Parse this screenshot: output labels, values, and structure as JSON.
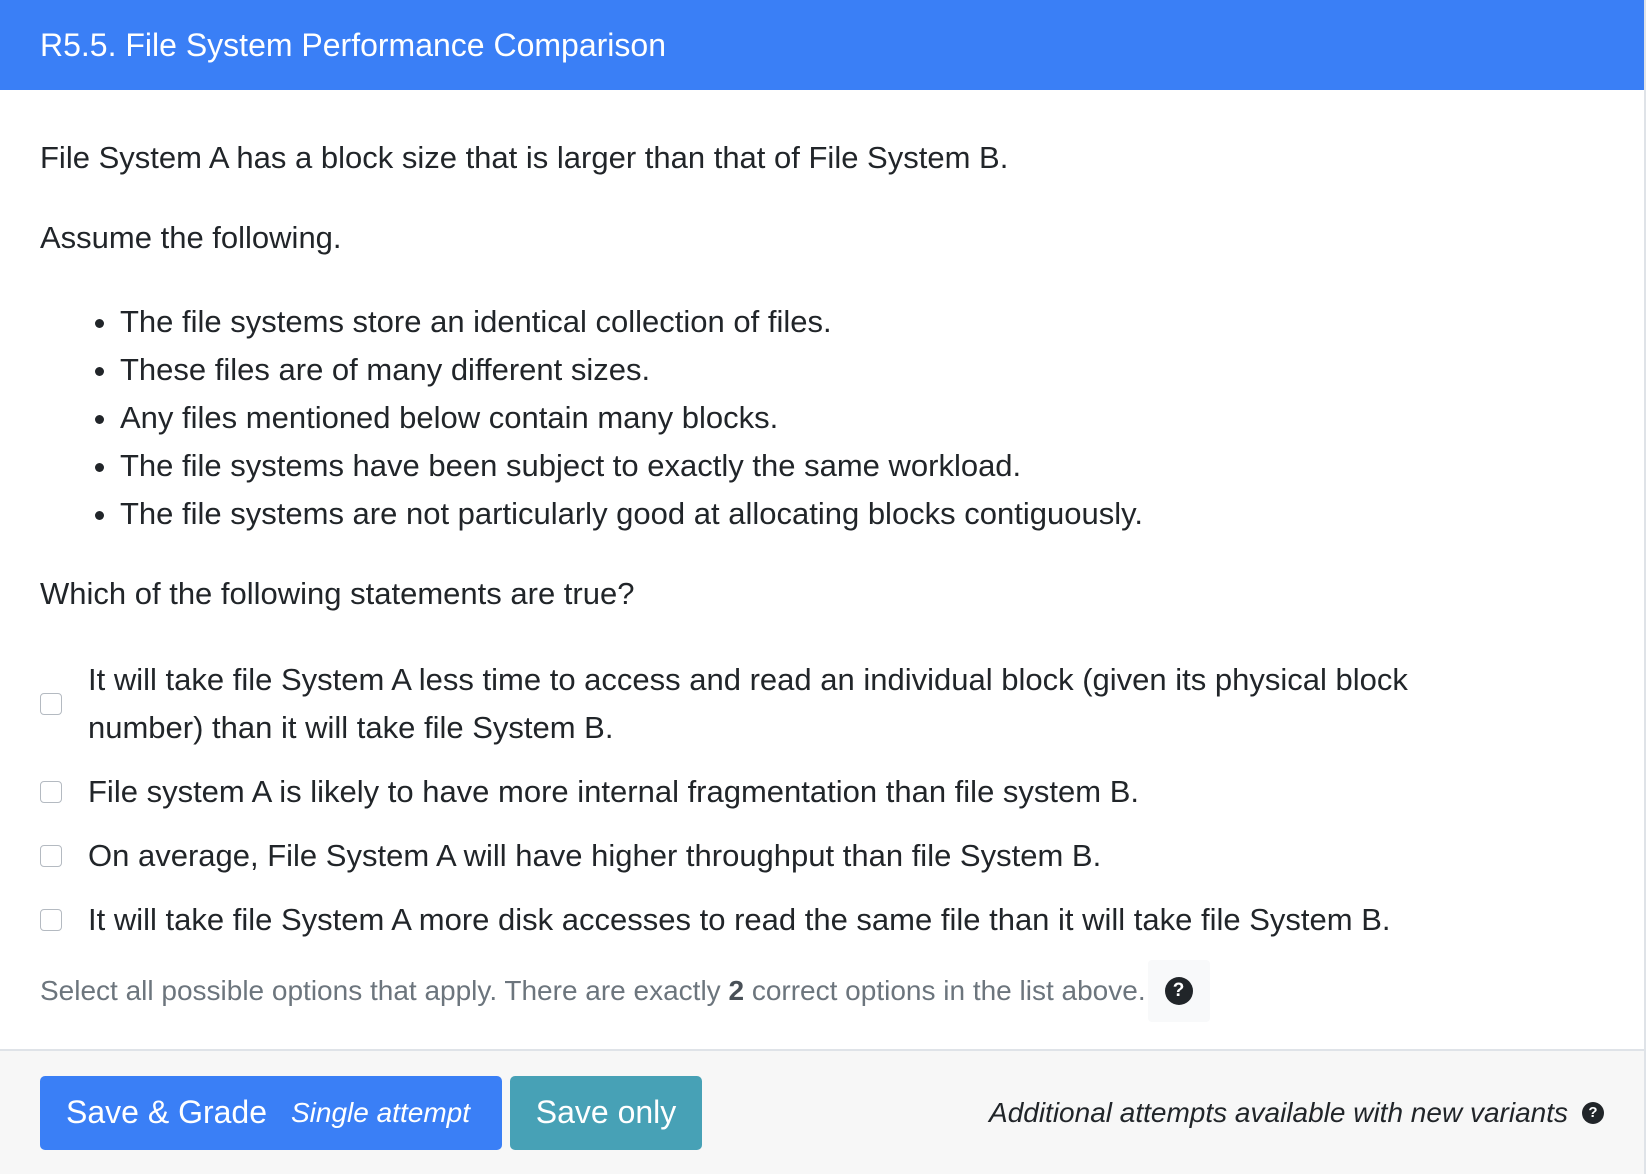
{
  "header": {
    "title": "R5.5. File System Performance Comparison"
  },
  "question": {
    "intro": "File System A has a block size that is larger than that of File System B.",
    "assume_label": "Assume the following.",
    "assumptions": [
      "The file systems store an identical collection of files.",
      "These files are of many different sizes.",
      "Any files mentioned below contain many blocks.",
      "The file systems have been subject to exactly the same workload.",
      "The file systems are not particularly good at allocating blocks contiguously."
    ],
    "prompt": "Which of the following statements are true?",
    "options": [
      "It will take file System A less time to access and read an individual block (given its physical block number) than it will take file System B.",
      "File system A is likely to have more internal fragmentation than file system B.",
      "On average, File System A will have higher throughput than file System B.",
      "It will take file System A more disk accesses to read the same file than it will take file System B."
    ],
    "hint_prefix": "Select all possible options that apply. There are exactly",
    "hint_count": "2",
    "hint_suffix": "correct options in the list above."
  },
  "footer": {
    "grade_label": "Save & Grade",
    "grade_sub": "Single attempt",
    "save_label": "Save only",
    "attempts_text": "Additional attempts available with new variants"
  },
  "icons": {
    "help": "question-circle-icon",
    "help_glyph": "?"
  },
  "colors": {
    "header": "#3a7ff6",
    "grade_button": "#3a7ff6",
    "save_button": "#47a1b6"
  }
}
